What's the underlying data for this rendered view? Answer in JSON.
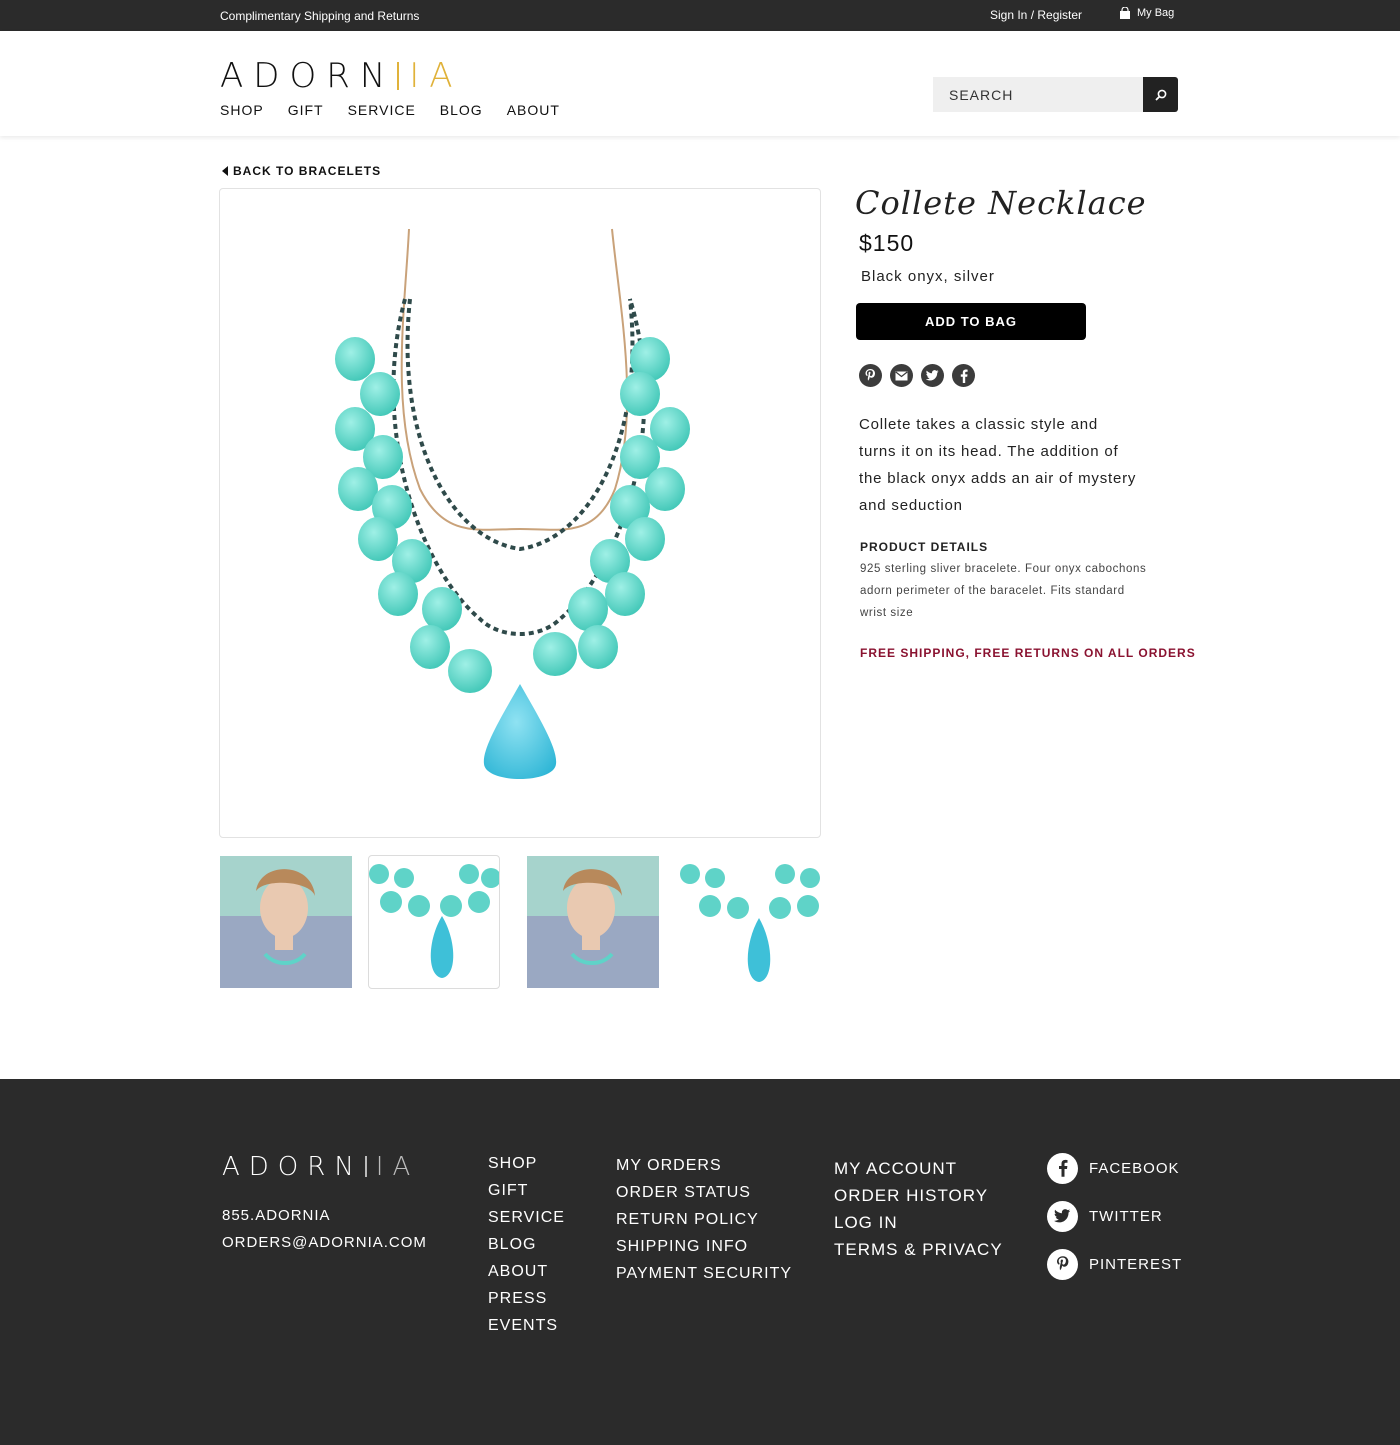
{
  "topbar": {
    "promo": "Complimentary Shipping and Returns",
    "signin": "Sign In / Register",
    "bag": "My Bag"
  },
  "header": {
    "logo_main": "ADORN",
    "logo_accent": "IA",
    "nav": [
      "SHOP",
      "GIFT",
      "SERVICE",
      "BLOG",
      "ABOUT"
    ],
    "search_placeholder": "SEARCH"
  },
  "back_link": "BACK TO BRACELETS",
  "product": {
    "title": "Collete Necklace",
    "price": "$150",
    "material": "Black onyx, silver",
    "add_to_bag": "ADD TO BAG",
    "share_icons": [
      "pinterest-icon",
      "email-icon",
      "twitter-icon",
      "facebook-icon"
    ],
    "description": "Collete takes a classic style and turns it on its head. The addition of the black onyx adds an air of mystery and seduction",
    "details_title": "PRODUCT DETAILS",
    "details_text": "925 sterling sliver bracelete. Four onyx cabochons adorn perimeter of the baracelet. Fits standard wrist size",
    "free_shipping": "FREE SHIPPING, FREE RETURNS ON ALL ORDERS"
  },
  "footer": {
    "logo_main": "ADORN",
    "logo_accent": "IA",
    "phone": "855.ADORNIA",
    "email": "ORDERS@ADORNIA.COM",
    "col1": [
      "SHOP",
      "GIFT",
      "SERVICE",
      "BLOG",
      "ABOUT",
      "PRESS",
      "EVENTS"
    ],
    "col2": [
      "MY ORDERS",
      "ORDER STATUS",
      "RETURN POLICY",
      "SHIPPING INFO",
      "PAYMENT SECURITY"
    ],
    "col3": [
      "MY ACCOUNT",
      "ORDER HISTORY",
      "LOG IN",
      "TERMS & PRIVACY"
    ],
    "social": [
      "FACEBOOK",
      "TWITTER",
      "PINTEREST"
    ]
  },
  "colors": {
    "dark": "#2b2b2b",
    "accent_gold": "#e0b23a",
    "free_shipping": "#8a1230",
    "stone": "#5fd3c8"
  }
}
